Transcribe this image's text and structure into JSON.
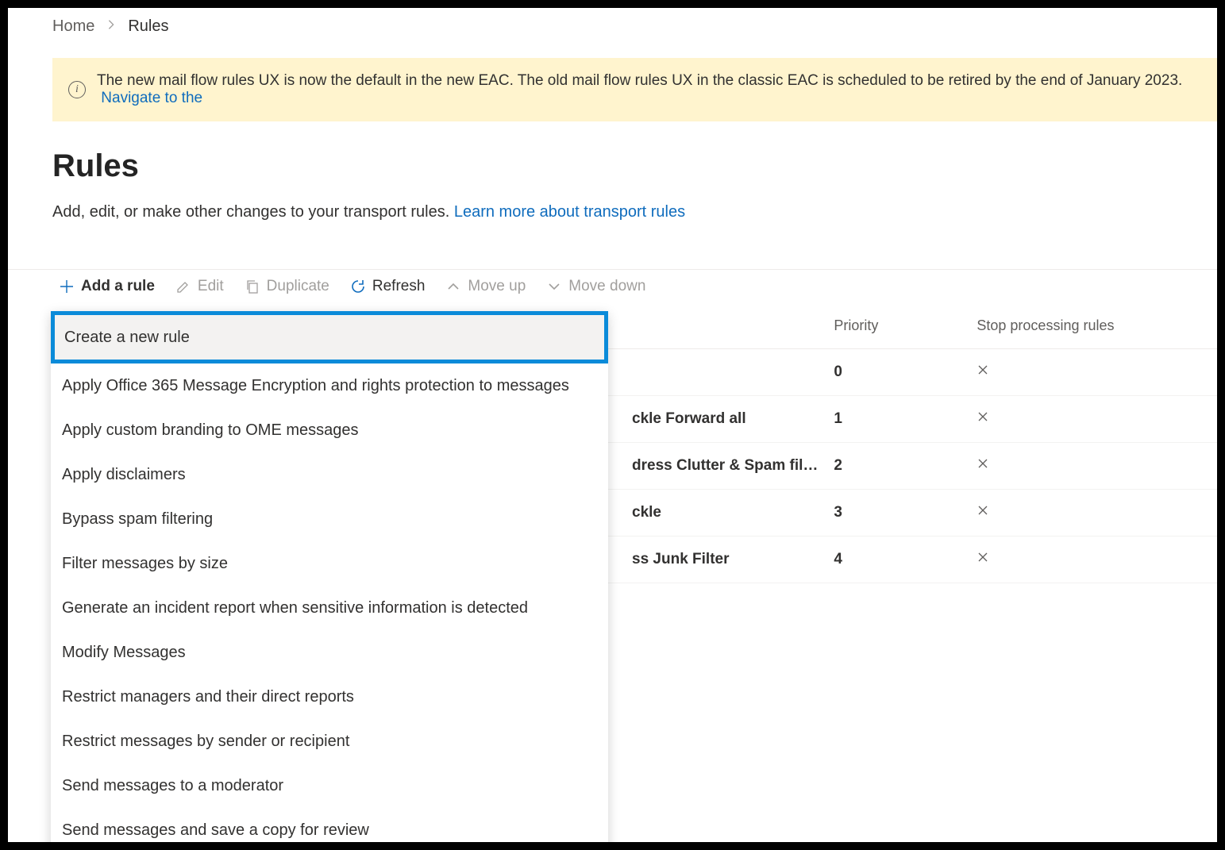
{
  "breadcrumb": {
    "home": "Home",
    "current": "Rules"
  },
  "banner": {
    "text": "The new mail flow rules UX is now the default in the new EAC. The old mail flow rules UX in the classic EAC is scheduled to be retired by the end of January 2023.",
    "link_text": "Navigate to the"
  },
  "page": {
    "title": "Rules",
    "sub": "Add, edit, or make other changes to your transport rules.",
    "sub_link": "Learn more about transport rules"
  },
  "toolbar": {
    "add": "Add a rule",
    "edit": "Edit",
    "duplicate": "Duplicate",
    "refresh": "Refresh",
    "moveup": "Move up",
    "movedown": "Move down"
  },
  "dropdown": {
    "items": [
      "Create a new rule",
      "Apply Office 365 Message Encryption and rights protection to messages",
      "Apply custom branding to OME messages",
      "Apply disclaimers",
      "Bypass spam filtering",
      "Filter messages by size",
      "Generate an incident report when sensitive information is detected",
      "Modify Messages",
      "Restrict managers and their direct reports",
      "Restrict messages by sender or recipient",
      "Send messages to a moderator",
      "Send messages and save a copy for review"
    ],
    "selected_index": 0
  },
  "table": {
    "headers": {
      "name": "",
      "priority": "Priority",
      "stop": "Stop processing rules"
    },
    "rows": [
      {
        "name": "",
        "priority": "0",
        "stop_icon": "close"
      },
      {
        "name": "ckle Forward all",
        "priority": "1",
        "stop_icon": "close"
      },
      {
        "name": "dress Clutter & Spam fil…",
        "priority": "2",
        "stop_icon": "close"
      },
      {
        "name": "ckle",
        "priority": "3",
        "stop_icon": "close"
      },
      {
        "name": "ss Junk Filter",
        "priority": "4",
        "stop_icon": "close"
      }
    ]
  }
}
